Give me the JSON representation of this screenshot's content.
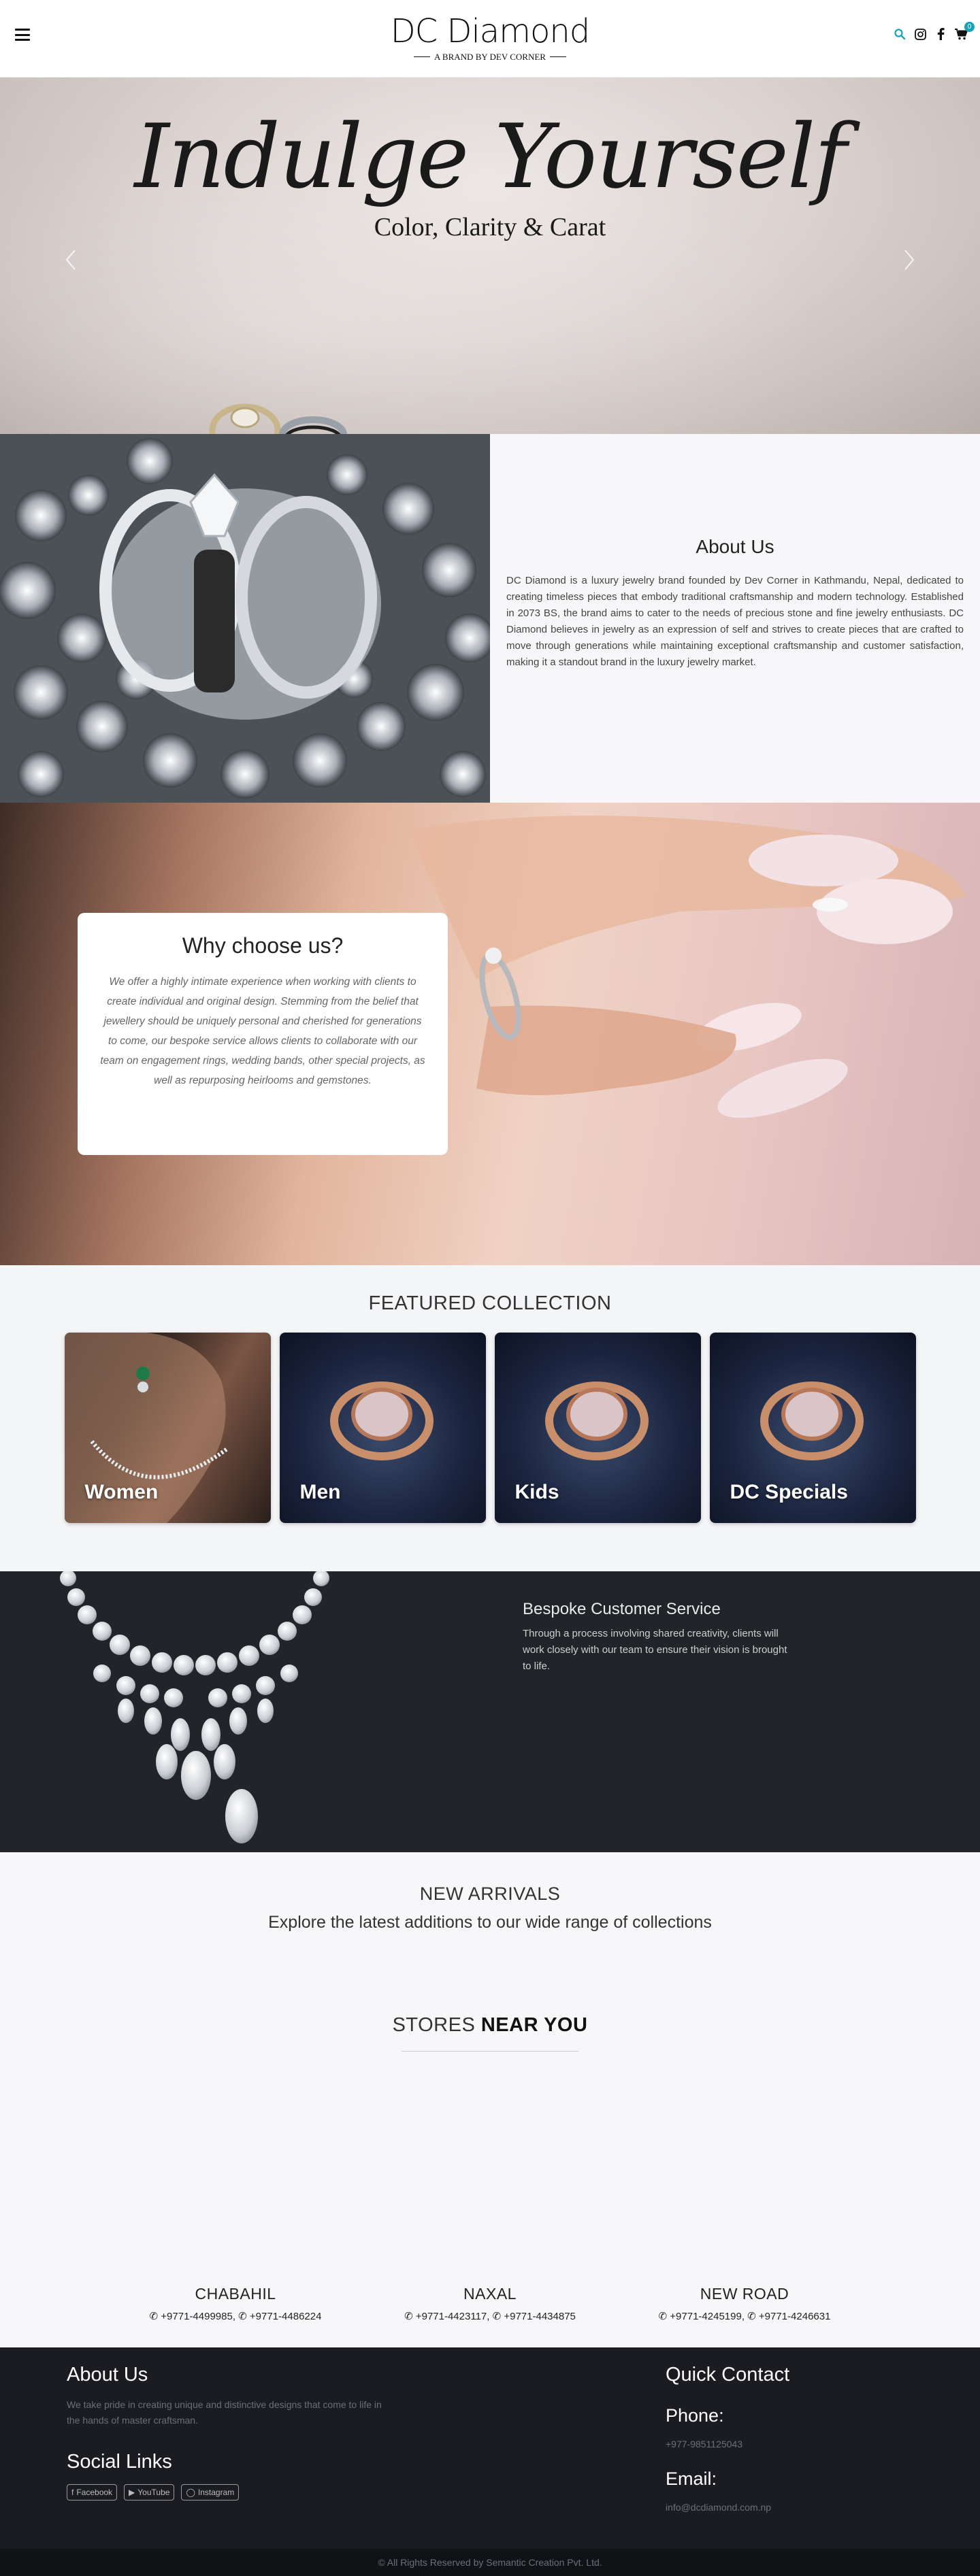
{
  "header": {
    "logo_title": "DC Diamond",
    "logo_sub": "A BRAND BY DEV CORNER",
    "cart_count": "0",
    "icons": [
      "menu-icon",
      "search-icon",
      "instagram-icon",
      "facebook-icon",
      "cart-icon"
    ],
    "colors": {
      "search": "#17a2b8",
      "badge": "#17a2b8"
    }
  },
  "hero": {
    "title": "Indulge Yourself",
    "subtitle": "Color, Clarity & Carat"
  },
  "about": {
    "heading": "About Us",
    "body": "DC Diamond is a luxury jewelry brand founded by Dev Corner in Kathmandu, Nepal, dedicated to creating timeless pieces that embody traditional craftsmanship and modern technology. Established in 2073 BS, the brand aims to cater to the needs of precious stone and fine jewelry enthusiasts. DC Diamond believes in jewelry as an expression of self and strives to create pieces that are crafted to move through generations while maintaining exceptional craftsmanship and customer satisfaction, making it a standout brand in the luxury jewelry market."
  },
  "why": {
    "heading": "Why choose us?",
    "body": "We offer a highly intimate experience when working with clients to create individual and original design. Stemming from the belief that jewellery should be uniquely personal and cherished for generations to come, our bespoke service allows clients to collaborate with our team on engagement rings, wedding bands, other special projects, as well as repurposing heirlooms and gemstones."
  },
  "featured": {
    "heading": "FEATURED COLLECTION",
    "cards": [
      {
        "label": "Women"
      },
      {
        "label": "Men"
      },
      {
        "label": "Kids"
      },
      {
        "label": "DC Specials"
      }
    ]
  },
  "bespoke": {
    "heading": "Bespoke Customer Service",
    "body": "Through a process involving shared creativity, clients will work closely with our team to ensure their vision is brought to life."
  },
  "arrivals": {
    "heading": "NEW ARRIVALS",
    "subtitle": "Explore the latest additions to our wide range of collections"
  },
  "stores": {
    "heading_light": "STORES ",
    "heading_bold": "NEAR YOU",
    "items": [
      {
        "name": "CHABAHIL",
        "phone1": "+9771-4499985",
        "phone2": "+9771-4486224"
      },
      {
        "name": "NAXAL",
        "phone1": "+9771-4423117",
        "phone2": "+9771-4434875"
      },
      {
        "name": "NEW ROAD",
        "phone1": "+9771-4245199",
        "phone2": "+9771-4246631"
      }
    ]
  },
  "footer": {
    "about_heading": "About Us",
    "about_body": "We take pride in creating unique and distinctive designs that come to life in the hands of master craftsman.",
    "social_heading": "Social Links",
    "social": [
      {
        "label": "Facebook",
        "icon": "facebook-icon"
      },
      {
        "label": "YouTube",
        "icon": "youtube-icon"
      },
      {
        "label": "Instagram",
        "icon": "instagram-icon"
      }
    ],
    "contact_heading": "Quick Contact",
    "phone_label": "Phone:",
    "phone": "+977-9851125043",
    "email_label": "Email:",
    "email": "info@dcdiamond.com.np"
  },
  "copyright": "© All Rights Reserved by Semantic Creation Pvt. Ltd."
}
